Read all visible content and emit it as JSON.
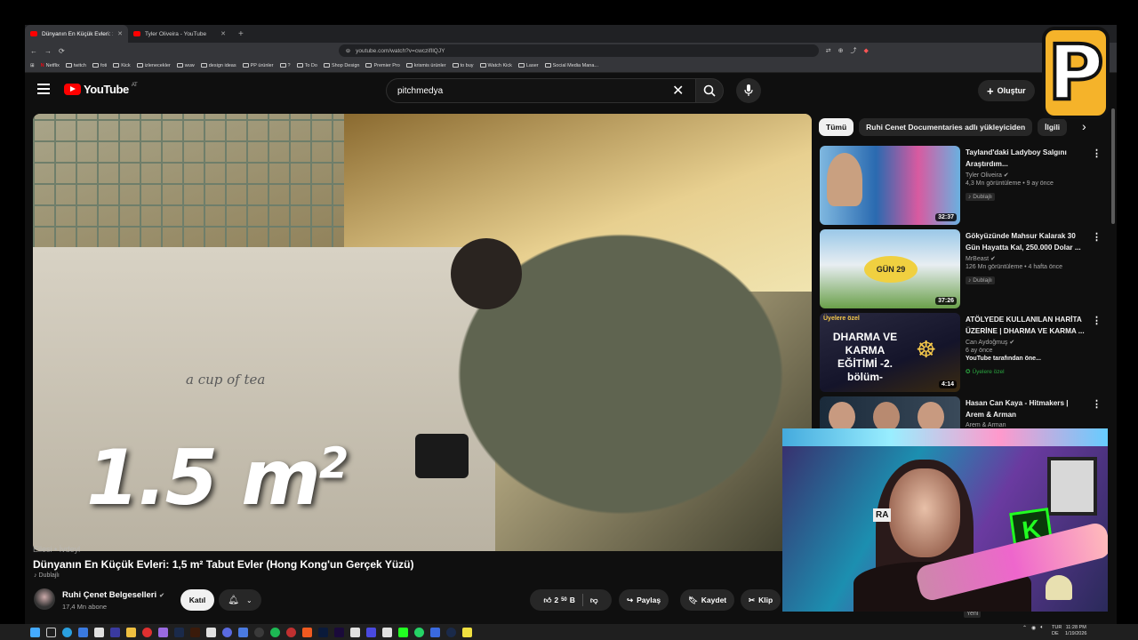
{
  "browser": {
    "tabs": [
      {
        "label": "Dünyanın En Küçük Evleri: 1,5 m²",
        "active": true
      },
      {
        "label": "Tyler Oliveira - YouTube",
        "active": false
      }
    ],
    "new_tab": "+",
    "url": "youtube.com/watch?v=cwczifIlQJY",
    "bookmarks": [
      "Netflix",
      "twitch",
      "foti",
      "Kick",
      "izlenecekler",
      "wuw",
      "design ideas",
      "PP ürünler",
      "?",
      "To Do",
      "Shop Design",
      "Premier Pro",
      "krismis ürünler",
      "to buy",
      "Watch Kick",
      "Laser",
      "Social Media Mana..."
    ]
  },
  "youtube": {
    "logo_text": "YouTube",
    "logo_region": "AT",
    "search_value": "pitchmedya",
    "create_label": "Oluştur",
    "video": {
      "overlay_text": "1.5 m",
      "overlay_sup": "2",
      "cup_text": "a cup of tea",
      "chapter_text": "Eilesi • İvdeyl",
      "title": "Dünyanın En Küçük Evleri: 1,5 m² Tabut Evler (Hong Kong'un Gerçek Yüzü)",
      "dubbed_label": "Dublajlı"
    },
    "channel": {
      "name": "Ruhi Çenet Belgeselleri",
      "subscribers": "17,4 Mn abone",
      "join_label": "Katıl"
    },
    "actions": {
      "likes": "2",
      "likes_sup": "50",
      "likes_unit": "B",
      "share": "Paylaş",
      "save": "Kaydet",
      "clip": "Klip"
    },
    "chips": [
      "Tümü",
      "Ruhi Cenet Documentaries adlı yükleyiciden",
      "İlgili"
    ],
    "recommendations": [
      {
        "title": "Tayland'daki Ladyboy Salgını Araştırdım...",
        "channel": "Tyler Oliveira",
        "meta": "4,3 Mn görüntüleme • 9 ay önce",
        "badge": "Dublajlı",
        "duration": "32:37"
      },
      {
        "title": "Gökyüzünde Mahsur Kalarak 30 Gün Hayatta Kal, 250.000 Dolar ...",
        "channel": "MrBeast",
        "meta": "126 Mn görüntüleme • 4 hafta önce",
        "badge": "Dublajlı",
        "duration": "37:26",
        "thumb_text": "GÜN 29"
      },
      {
        "title": "ATÖLYEDE KULLANILAN HARİTA ÜZERİNE | DHARMA VE KARMA ...",
        "channel": "Can Aydoğmuş",
        "meta": "6 ay önce",
        "extra": "YouTube tarafından öne...",
        "badge": "Üyelere özel",
        "duration": "4:14",
        "thumb_tag": "Üyelere özel",
        "thumb_title": "DHARMA VE KARMA EĞİTİMİ -2. bölüm-"
      },
      {
        "title": "Hasan Can Kaya - Hitmakers | Arem & Arman",
        "channel": "Arem & Arman",
        "meta": "",
        "badge": "",
        "duration": ""
      }
    ],
    "new_badge": "Yeni"
  },
  "stream_logo": "P",
  "webcam": {
    "sign_text": "RA",
    "k_letter": "K"
  },
  "taskbar": {
    "lang_top": "TUR",
    "lang_bottom": "DE",
    "time": "11:28 PM",
    "date": "1/19/2026"
  }
}
